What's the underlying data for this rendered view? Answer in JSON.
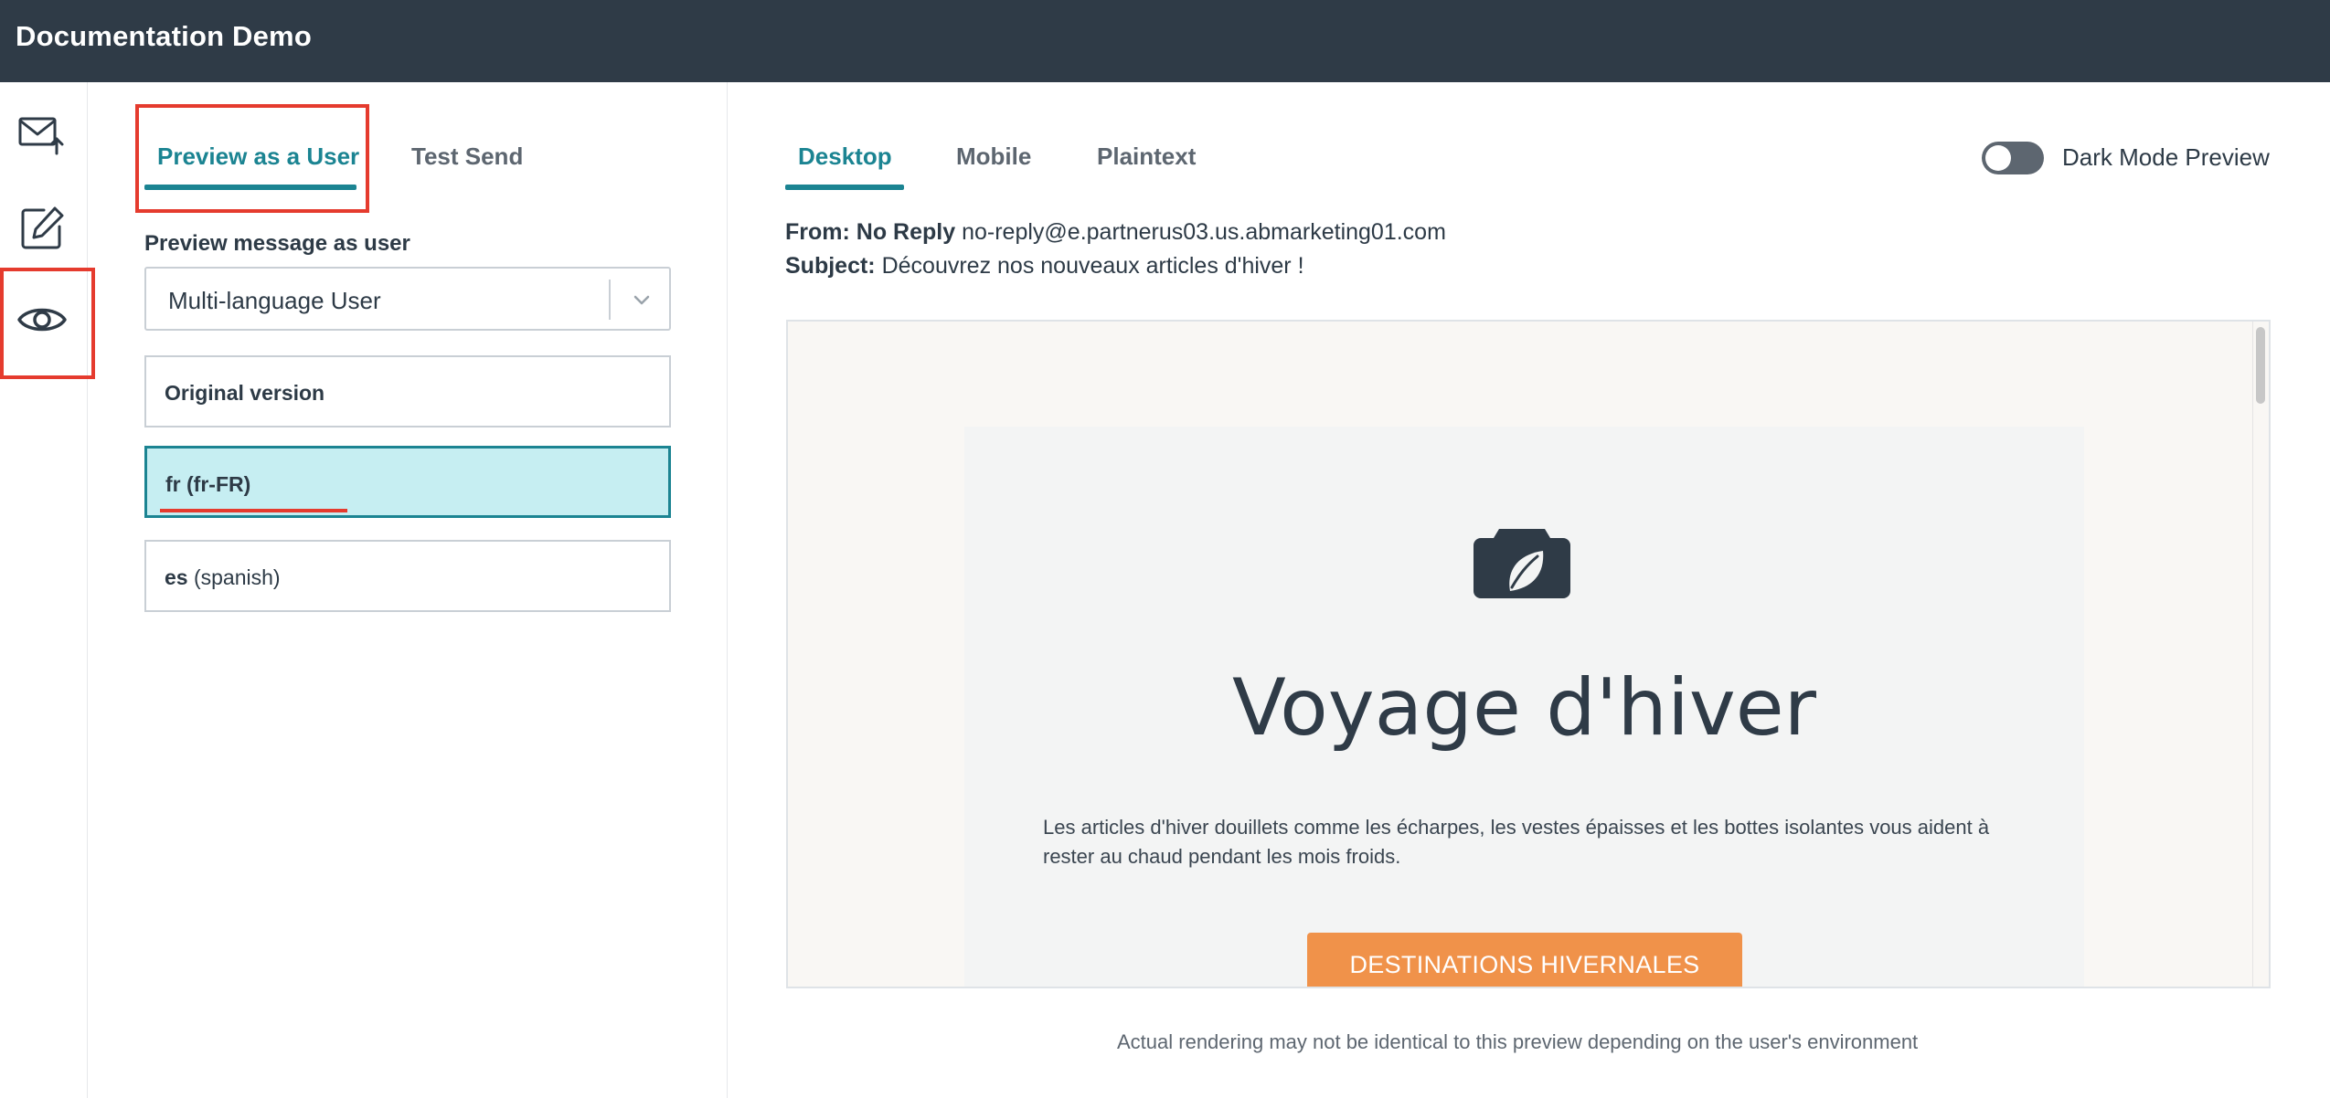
{
  "app": {
    "title": "Documentation Demo"
  },
  "rail": {
    "icons": [
      "envelope-send-icon",
      "edit-icon",
      "eye-icon"
    ]
  },
  "left_panel": {
    "tabs": [
      {
        "label": "Preview as a User",
        "active": true
      },
      {
        "label": "Test Send",
        "active": false
      }
    ],
    "preview_label": "Preview message as user",
    "selected_user": "Multi-language User",
    "versions": [
      {
        "code": "Original version",
        "name": ""
      },
      {
        "code": "fr",
        "name": "(fr-FR)",
        "selected": true
      },
      {
        "code": "es",
        "name": "(spanish)"
      }
    ]
  },
  "preview": {
    "tabs": [
      {
        "label": "Desktop",
        "active": true
      },
      {
        "label": "Mobile",
        "active": false
      },
      {
        "label": "Plaintext",
        "active": false
      }
    ],
    "dark_mode_label": "Dark Mode Preview",
    "dark_mode_on": false,
    "from_label": "From:",
    "from_name": "No Reply",
    "from_email": "no-reply@e.partnerus03.us.abmarketing01.com",
    "subject_label": "Subject:",
    "subject": "Découvrez nos nouveaux articles d'hiver !",
    "email": {
      "title": "Voyage d'hiver",
      "body": "Les articles d'hiver douillets comme les écharpes, les vestes épaisses et les bottes isolantes vous aident à rester au chaud pendant les mois froids.",
      "cta": "DESTINATIONS HIVERNALES"
    },
    "disclaimer": "Actual rendering may not be identical to this preview depending on the user's environment"
  },
  "colors": {
    "topbar": "#2f3b47",
    "accent": "#1b8492",
    "highlight": "#e53b2e",
    "selected_bg": "#c6eef2",
    "cta": "#f0924a"
  }
}
